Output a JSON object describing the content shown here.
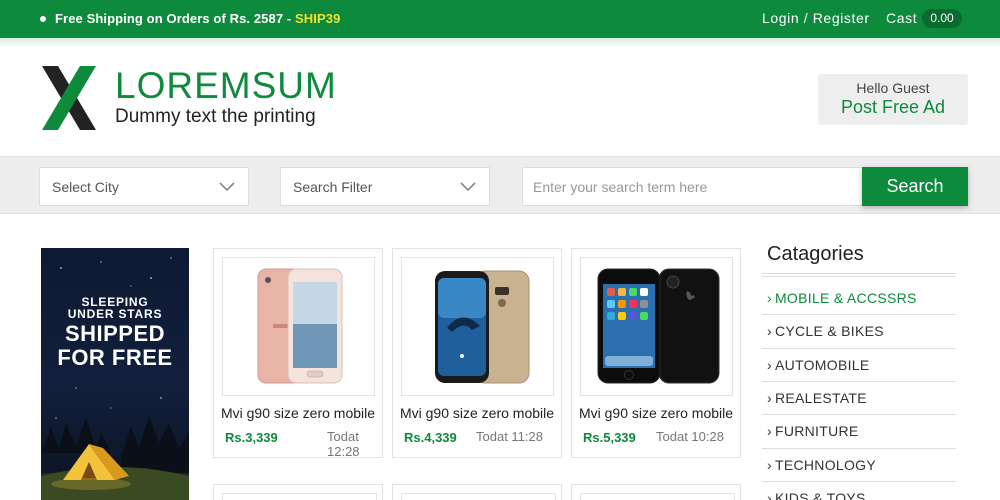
{
  "topbar": {
    "promo_text": "Free Shipping on Orders of Rs. 2587 - ",
    "promo_code": "SHIP39",
    "login_register": "Login / Register",
    "cart_label": "Cast",
    "cart_value": "0.00"
  },
  "header": {
    "brand": "LOREMSUM",
    "tagline": "Dummy text the printing",
    "hello": "Hello Guest",
    "post_ad": "Post Free Ad"
  },
  "search": {
    "city_select": "Select City",
    "filter_select": "Search Filter",
    "placeholder": "Enter your search term here",
    "button": "Search"
  },
  "banner": {
    "line1": "SLEEPING",
    "line2": "UNDER STARS",
    "line3": "SHIPPED",
    "line4": "FOR FREE"
  },
  "products": [
    {
      "title": "Mvi g90 size zero mobile",
      "price": "Rs.3,339",
      "time": "Todat 12:28"
    },
    {
      "title": "Mvi g90 size zero mobile",
      "price": "Rs.4,339",
      "time": "Todat 11:28"
    },
    {
      "title": "Mvi g90 size zero mobile",
      "price": "Rs.5,339",
      "time": "Todat 10:28"
    }
  ],
  "categories": {
    "title": "Catagories",
    "items": [
      {
        "label": "MOBILE & ACCSSRS"
      },
      {
        "label": "CYCLE & BIKES"
      },
      {
        "label": "AUTOMOBILE"
      },
      {
        "label": "REALESTATE"
      },
      {
        "label": "FURNITURE"
      },
      {
        "label": "TECHNOLOGY"
      },
      {
        "label": "KIDS & TOYS"
      }
    ]
  },
  "colors": {
    "brand_green": "#0d8a3c",
    "promo_code_yellow": "#f2e02b"
  }
}
